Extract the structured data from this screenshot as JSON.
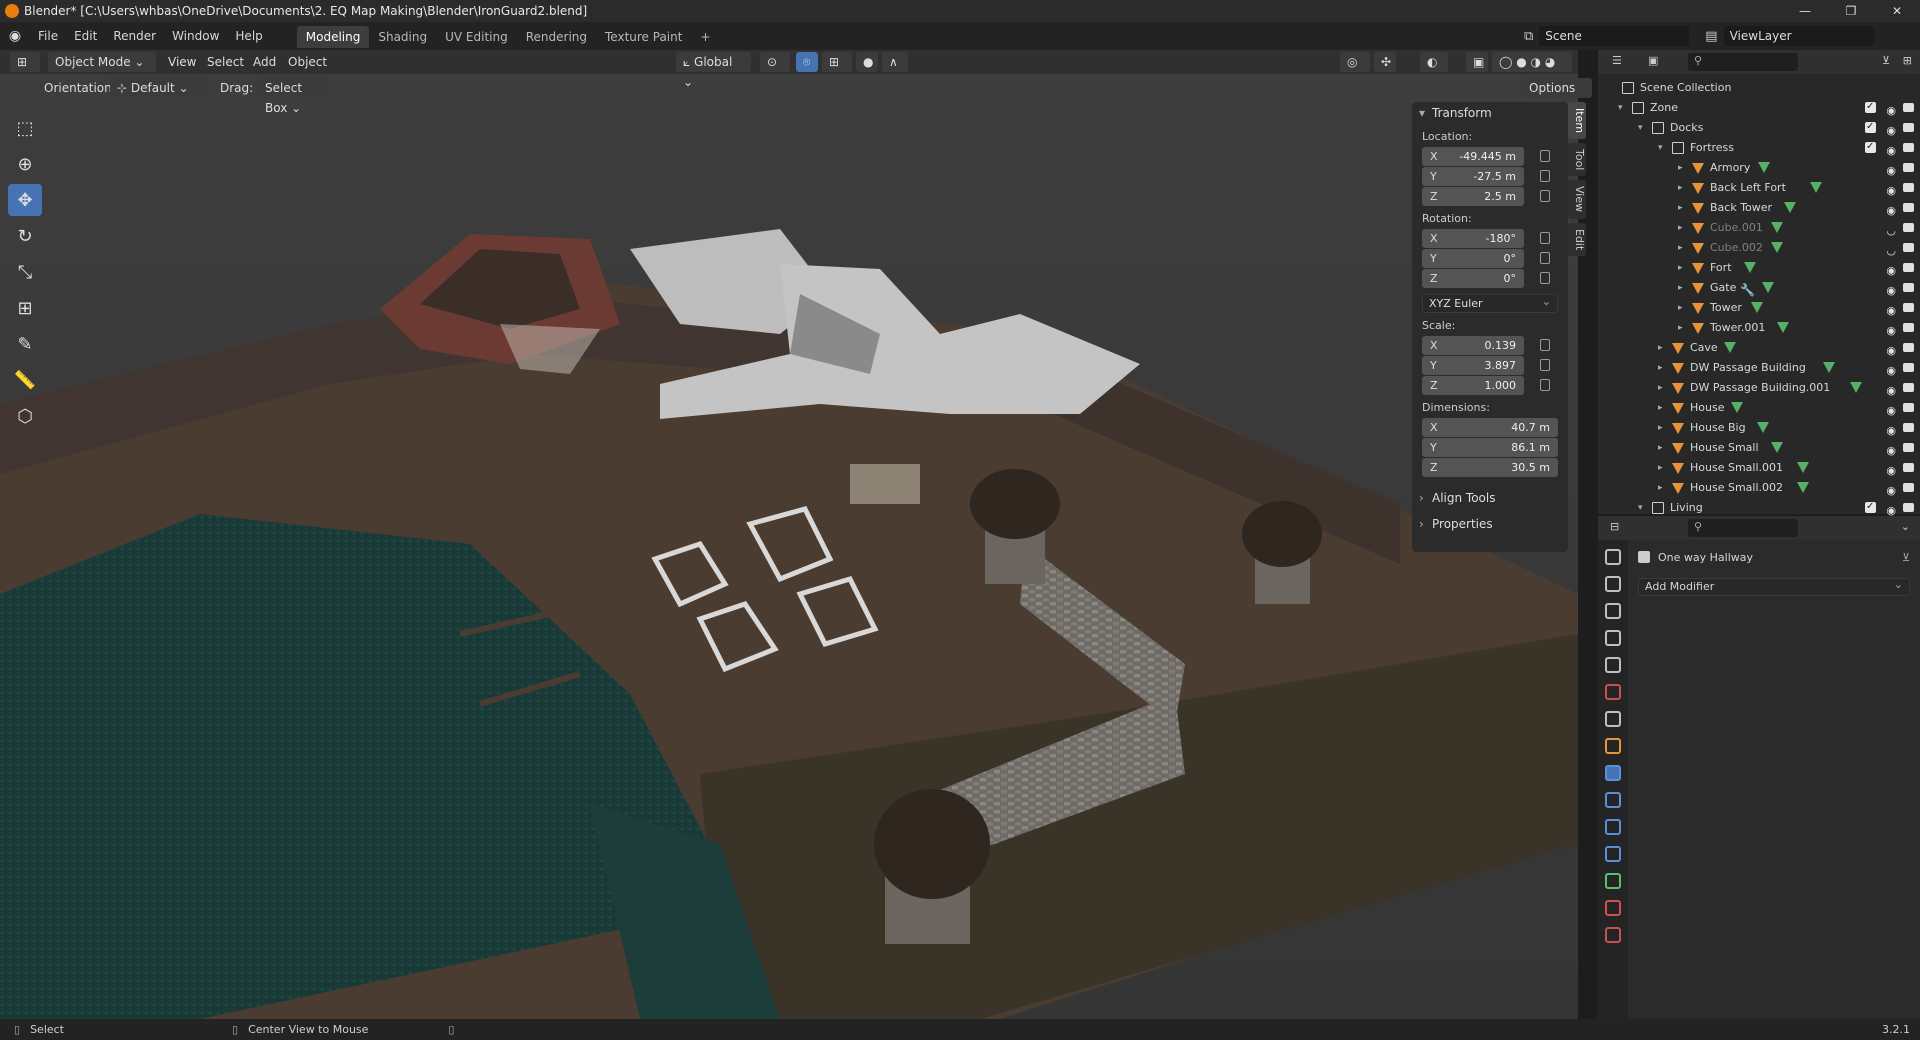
{
  "window": {
    "title": "Blender* [C:\\Users\\whbas\\OneDrive\\Documents\\2. EQ Map Making\\Blender\\IronGuard2.blend]",
    "controls": [
      "—",
      "❐",
      "✕"
    ]
  },
  "menubar": {
    "menus": [
      "File",
      "Edit",
      "Render",
      "Window",
      "Help"
    ],
    "workspaces": [
      "Modeling",
      "Shading",
      "UV Editing",
      "Rendering",
      "Texture Paint",
      "+"
    ],
    "active_workspace": "Modeling",
    "scene": "Scene",
    "view_layer": "ViewLayer"
  },
  "viewport_header": {
    "mode": "Object Mode",
    "menus": [
      "View",
      "Select",
      "Add",
      "Object"
    ],
    "transform_orientation": "Global",
    "orientation_label": "Orientation:",
    "orientation_value": "Default",
    "drag_label": "Drag:",
    "drag_value": "Select Box",
    "options_label": "Options"
  },
  "toolbar": {
    "tools": [
      "select-box",
      "cursor",
      "move",
      "rotate",
      "scale",
      "transform",
      "annotate",
      "measure",
      "add-cube"
    ],
    "active_tool": "move"
  },
  "npanel": {
    "tabs": [
      "Item",
      "Tool",
      "View",
      "Edit"
    ],
    "active_tab": "Item",
    "transform_header": "Transform",
    "location_label": "Location:",
    "location": [
      {
        "axis": "X",
        "value": "-49.445 m"
      },
      {
        "axis": "Y",
        "value": "-27.5 m"
      },
      {
        "axis": "Z",
        "value": "2.5 m"
      }
    ],
    "rotation_label": "Rotation:",
    "rotation": [
      {
        "axis": "X",
        "value": "-180°"
      },
      {
        "axis": "Y",
        "value": "0°"
      },
      {
        "axis": "Z",
        "value": "0°"
      }
    ],
    "rotation_mode": "XYZ Euler",
    "scale_label": "Scale:",
    "scale": [
      {
        "axis": "X",
        "value": "0.139"
      },
      {
        "axis": "Y",
        "value": "3.897"
      },
      {
        "axis": "Z",
        "value": "1.000"
      }
    ],
    "dimensions_label": "Dimensions:",
    "dimensions": [
      {
        "axis": "X",
        "value": "40.7 m"
      },
      {
        "axis": "Y",
        "value": "86.1 m"
      },
      {
        "axis": "Z",
        "value": "30.5 m"
      }
    ],
    "align_tools": "Align Tools",
    "properties": "Properties"
  },
  "outliner": {
    "root": "Scene Collection",
    "rows": [
      {
        "label": "Zone",
        "level": 0,
        "type": "collection",
        "checked": true,
        "arrow": "▾"
      },
      {
        "label": "Docks",
        "level": 1,
        "type": "collection",
        "checked": true,
        "arrow": "▾"
      },
      {
        "label": "Fortress",
        "level": 2,
        "type": "collection",
        "checked": true,
        "arrow": "▾"
      },
      {
        "label": "Armory",
        "level": 3,
        "type": "mesh",
        "arrow": "▸"
      },
      {
        "label": "Back Left Fort",
        "level": 3,
        "type": "mesh",
        "arrow": "▸"
      },
      {
        "label": "Back Tower",
        "level": 3,
        "type": "mesh",
        "arrow": "▸"
      },
      {
        "label": "Cube.001",
        "level": 3,
        "type": "mesh",
        "dim": true,
        "arrow": "▸"
      },
      {
        "label": "Cube.002",
        "level": 3,
        "type": "mesh",
        "dim": true,
        "arrow": "▸"
      },
      {
        "label": "Fort",
        "level": 3,
        "type": "mesh",
        "arrow": "▸"
      },
      {
        "label": "Gate",
        "level": 3,
        "type": "mesh",
        "modifier": true,
        "arrow": "▸"
      },
      {
        "label": "Tower",
        "level": 3,
        "type": "mesh",
        "arrow": "▸"
      },
      {
        "label": "Tower.001",
        "level": 3,
        "type": "mesh",
        "arrow": "▸"
      },
      {
        "label": "Cave",
        "level": 2,
        "type": "mesh",
        "arrow": "▸"
      },
      {
        "label": "DW Passage Building",
        "level": 2,
        "type": "mesh",
        "arrow": "▸"
      },
      {
        "label": "DW Passage Building.001",
        "level": 2,
        "type": "mesh",
        "arrow": "▸"
      },
      {
        "label": "House",
        "level": 2,
        "type": "mesh",
        "arrow": "▸"
      },
      {
        "label": "House Big",
        "level": 2,
        "type": "mesh",
        "arrow": "▸"
      },
      {
        "label": "House Small",
        "level": 2,
        "type": "mesh",
        "arrow": "▸"
      },
      {
        "label": "House Small.001",
        "level": 2,
        "type": "mesh",
        "arrow": "▸"
      },
      {
        "label": "House Small.002",
        "level": 2,
        "type": "mesh",
        "arrow": "▸"
      },
      {
        "label": "Living",
        "level": 1,
        "type": "collection",
        "checked": true,
        "arrow": "▾"
      }
    ]
  },
  "properties": {
    "object_name": "One way Hallway",
    "add_modifier": "Add Modifier",
    "tab_icons": [
      "tool",
      "render",
      "output",
      "view-layer",
      "scene",
      "world",
      "collection",
      "object",
      "modifier",
      "particles",
      "physics",
      "constraints",
      "data",
      "material",
      "texture"
    ],
    "tab_colors": [
      "#bfbfbf",
      "#bfbfbf",
      "#bfbfbf",
      "#bfbfbf",
      "#bfbfbf",
      "#c85050",
      "#bfbfbf",
      "#e8923a",
      "#5a8fdc",
      "#5a8fdc",
      "#5a8fdc",
      "#5a8fdc",
      "#5bbf6c",
      "#d05050",
      "#c85050"
    ]
  },
  "statusbar": {
    "left_action": "Select",
    "middle_action": "Center View to Mouse",
    "version": "3.2.1"
  }
}
